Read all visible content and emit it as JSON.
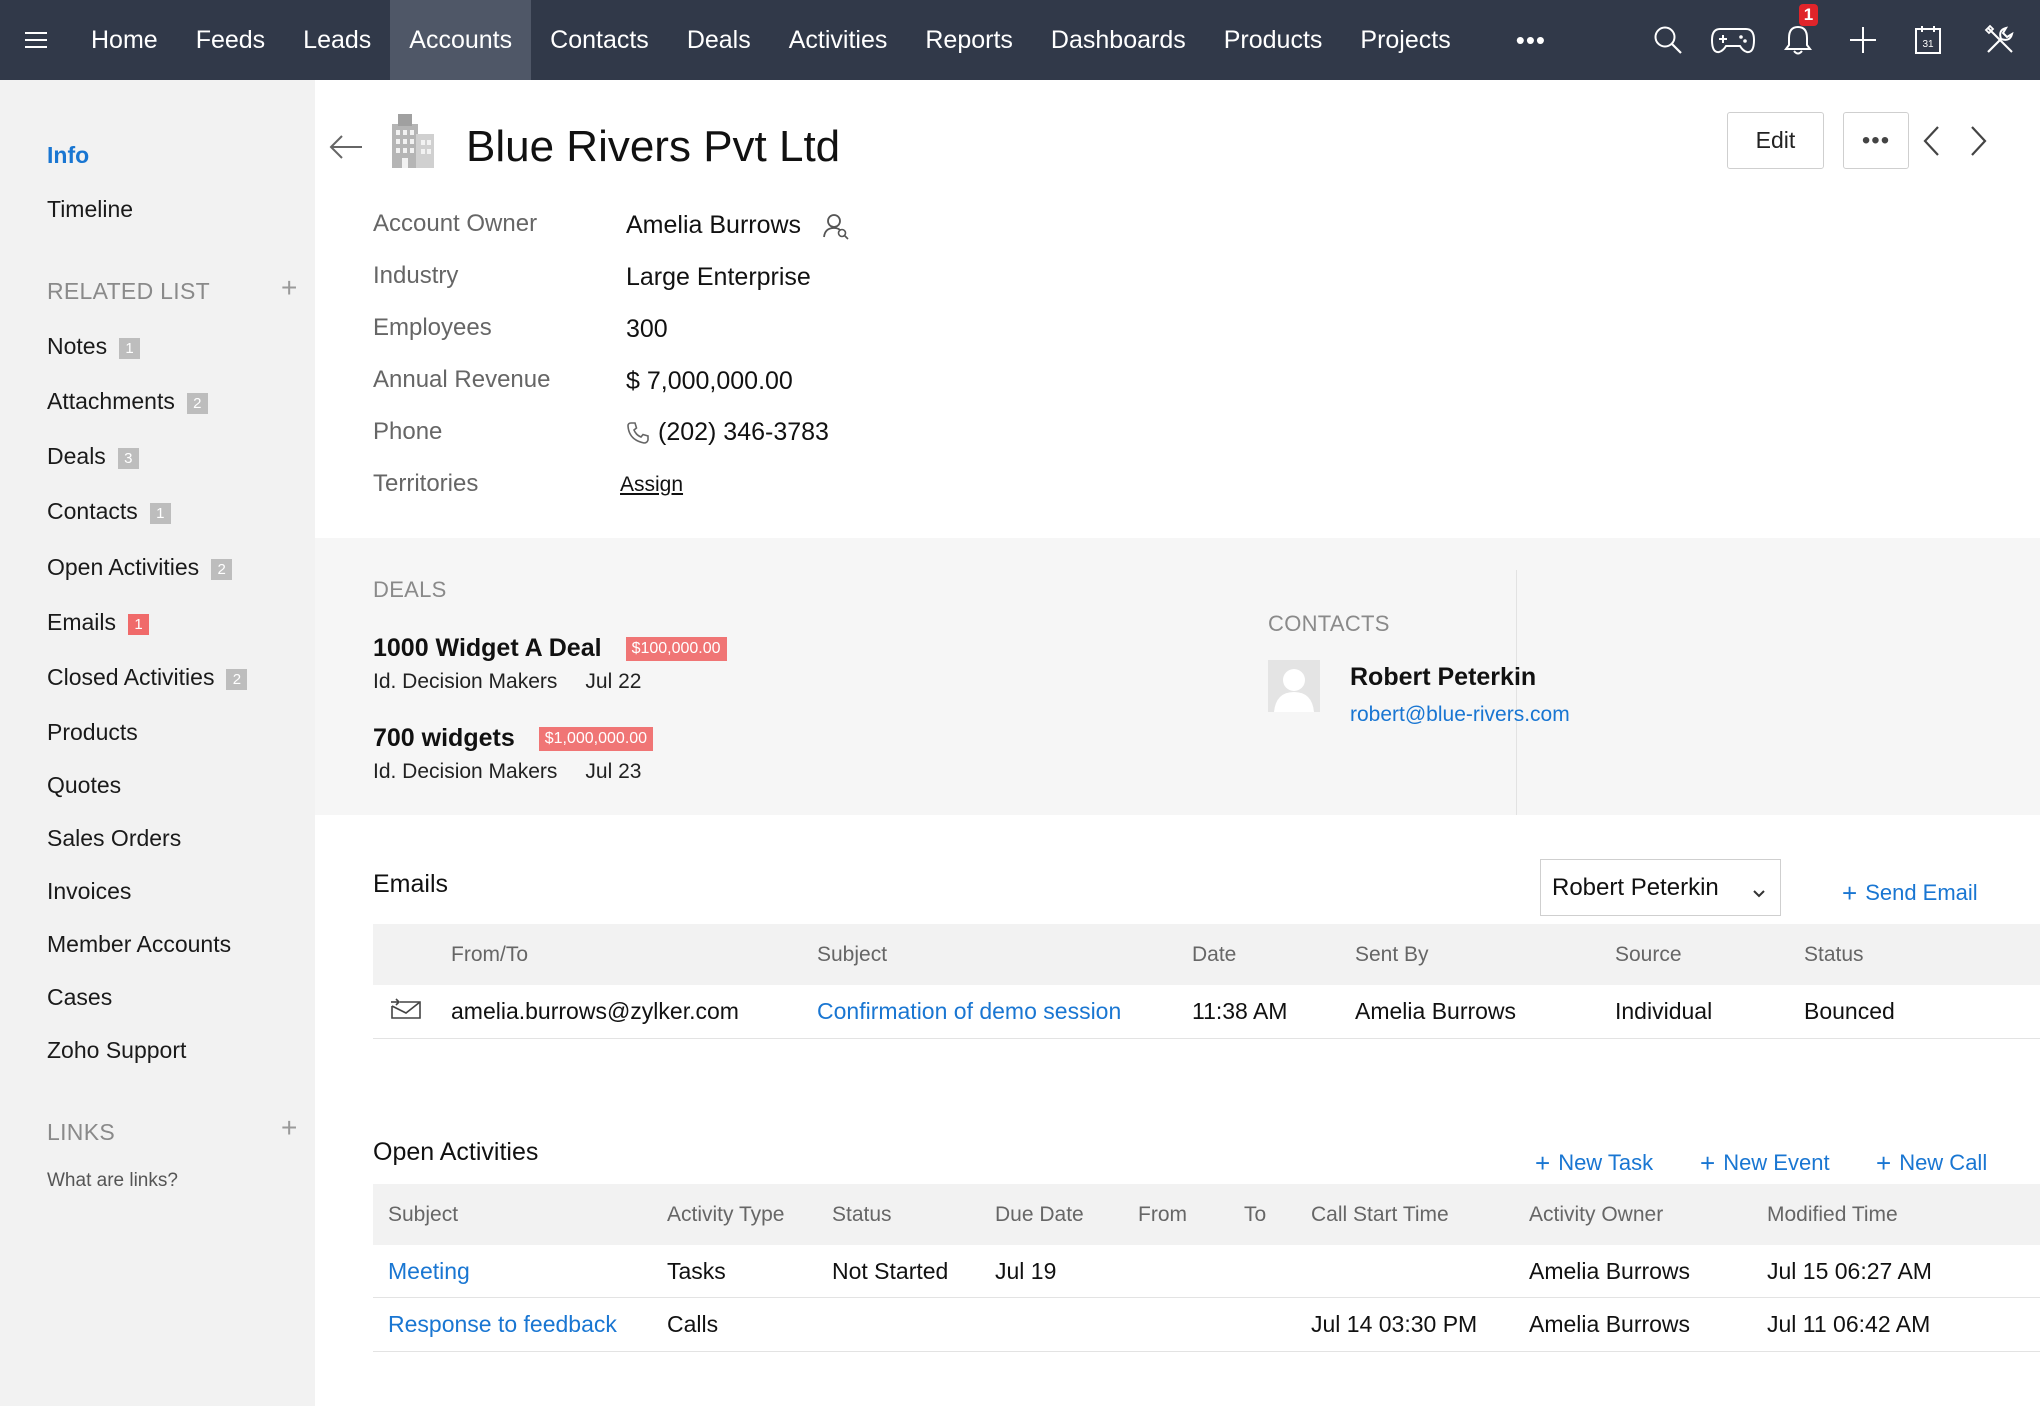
{
  "nav": {
    "items": [
      "Home",
      "Feeds",
      "Leads",
      "Accounts",
      "Contacts",
      "Deals",
      "Activities",
      "Reports",
      "Dashboards",
      "Products",
      "Projects"
    ],
    "active": "Accounts",
    "more": "•••",
    "notification_count": "1",
    "icons": [
      "search-icon",
      "gamepad-icon",
      "bell-icon",
      "plus-icon",
      "calendar-icon",
      "tools-icon"
    ]
  },
  "sidebar": {
    "info": "Info",
    "timeline": "Timeline",
    "related_head": "RELATED LIST",
    "related": [
      {
        "label": "Notes",
        "count": "1"
      },
      {
        "label": "Attachments",
        "count": "2"
      },
      {
        "label": "Deals",
        "count": "3"
      },
      {
        "label": "Contacts",
        "count": "1"
      },
      {
        "label": "Open Activities",
        "count": "2"
      },
      {
        "label": "Emails",
        "count": "1"
      },
      {
        "label": "Closed Activities",
        "count": "2"
      },
      {
        "label": "Products"
      },
      {
        "label": "Quotes"
      },
      {
        "label": "Sales Orders"
      },
      {
        "label": "Invoices"
      },
      {
        "label": "Member Accounts"
      },
      {
        "label": "Cases"
      },
      {
        "label": "Zoho Support"
      }
    ],
    "links_head": "LINKS",
    "links_help": "What are links?"
  },
  "header": {
    "title": "Blue Rivers Pvt Ltd",
    "edit": "Edit",
    "more": "•••"
  },
  "fields": [
    {
      "label": "Account Owner",
      "value": "Amelia Burrows"
    },
    {
      "label": "Industry",
      "value": "Large Enterprise"
    },
    {
      "label": "Employees",
      "value": "300"
    },
    {
      "label": "Annual Revenue",
      "value": "$ 7,000,000.00"
    },
    {
      "label": "Phone",
      "value": "(202) 346-3783"
    },
    {
      "label": "Territories",
      "value": "Assign"
    }
  ],
  "deals": {
    "heading": "DEALS",
    "items": [
      {
        "name": "1000 Widget A Deal",
        "amount": "$100,000.00",
        "stage": "Id. Decision Makers",
        "date": "Jul 22"
      },
      {
        "name": "700 widgets",
        "amount": "$1,000,000.00",
        "stage": "Id. Decision Makers",
        "date": "Jul 23"
      }
    ]
  },
  "contacts": {
    "heading": "CONTACTS",
    "name": "Robert Peterkin",
    "email": "robert@blue-rivers.com"
  },
  "emails": {
    "title": "Emails",
    "filter": "Robert Peterkin",
    "send": "Send Email",
    "columns": [
      "From/To",
      "Subject",
      "Date",
      "Sent By",
      "Source",
      "Status"
    ],
    "rows": [
      {
        "from": "amelia.burrows@zylker.com",
        "subject": "Confirmation of demo session",
        "date": "11:38 AM",
        "sent_by": "Amelia Burrows",
        "source": "Individual",
        "status": "Bounced"
      }
    ]
  },
  "open_activities": {
    "title": "Open Activities",
    "actions": [
      "New Task",
      "New Event",
      "New Call"
    ],
    "columns": [
      "Subject",
      "Activity Type",
      "Status",
      "Due Date",
      "From",
      "To",
      "Call Start Time",
      "Activity Owner",
      "Modified Time"
    ],
    "rows": [
      {
        "subject": "Meeting",
        "type": "Tasks",
        "status": "Not Started",
        "due": "Jul 19",
        "from": "",
        "to": "",
        "call_start": "",
        "owner": "Amelia Burrows",
        "modified": "Jul 15 06:27 AM"
      },
      {
        "subject": "Response to feedback",
        "type": "Calls",
        "status": "",
        "due": "",
        "from": "",
        "to": "",
        "call_start": "Jul 14 03:30 PM",
        "owner": "Amelia Burrows",
        "modified": "Jul 11 06:42 AM"
      }
    ]
  },
  "colors": {
    "nav_bg": "#313949",
    "nav_active": "#4f5767",
    "link": "#1976d2",
    "amount_badge": "#f07575",
    "notification": "#e0242a"
  }
}
